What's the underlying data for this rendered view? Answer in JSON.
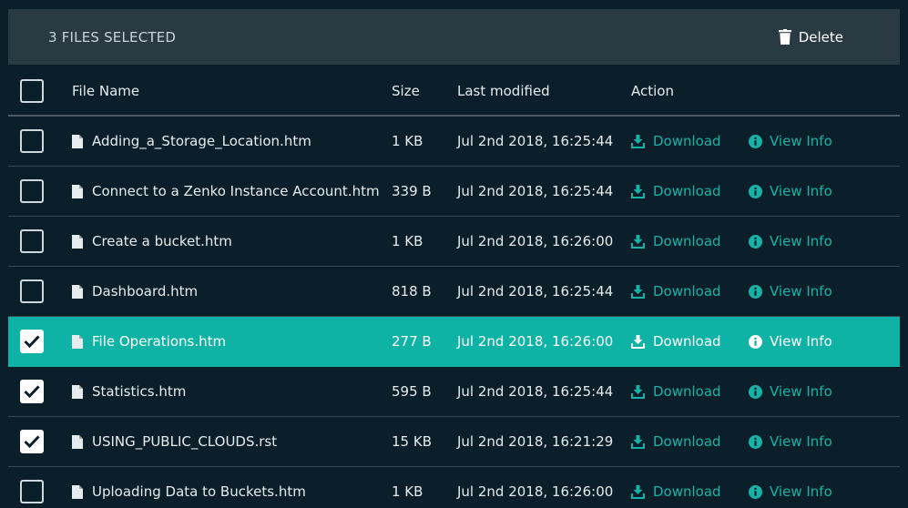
{
  "toolbar": {
    "selected_text": "3 FILES SELECTED",
    "delete_label": "Delete"
  },
  "columns": {
    "file_name": "File Name",
    "size": "Size",
    "last_modified": "Last modified",
    "action": "Action"
  },
  "actions": {
    "download_label": "Download",
    "view_info_label": "View Info"
  },
  "colors": {
    "accent": "#17b3a6",
    "selected_row": "#0fb3a5",
    "background": "#0b1f2a",
    "toolbar": "#2a3a42"
  },
  "icons": {
    "delete": "trash-icon",
    "file": "file-icon",
    "download": "download-icon",
    "info": "info-icon",
    "check": "checkmark-icon"
  },
  "files": [
    {
      "name": "Adding_a_Storage_Location.htm",
      "size": "1 KB",
      "modified": "Jul 2nd 2018, 16:25:44",
      "checked": false,
      "highlighted": false
    },
    {
      "name": "Connect to a Zenko Instance Account.htm",
      "size": "339 B",
      "modified": "Jul 2nd 2018, 16:25:44",
      "checked": false,
      "highlighted": false
    },
    {
      "name": "Create a bucket.htm",
      "size": "1 KB",
      "modified": "Jul 2nd 2018, 16:26:00",
      "checked": false,
      "highlighted": false
    },
    {
      "name": "Dashboard.htm",
      "size": "818 B",
      "modified": "Jul 2nd 2018, 16:25:44",
      "checked": false,
      "highlighted": false
    },
    {
      "name": "File Operations.htm",
      "size": "277 B",
      "modified": "Jul 2nd 2018, 16:26:00",
      "checked": true,
      "highlighted": true
    },
    {
      "name": "Statistics.htm",
      "size": "595 B",
      "modified": "Jul 2nd 2018, 16:25:44",
      "checked": true,
      "highlighted": false
    },
    {
      "name": "USING_PUBLIC_CLOUDS.rst",
      "size": "15 KB",
      "modified": "Jul 2nd 2018, 16:21:29",
      "checked": true,
      "highlighted": false
    },
    {
      "name": "Uploading Data to Buckets.htm",
      "size": "1 KB",
      "modified": "Jul 2nd 2018, 16:26:00",
      "checked": false,
      "highlighted": false
    }
  ]
}
